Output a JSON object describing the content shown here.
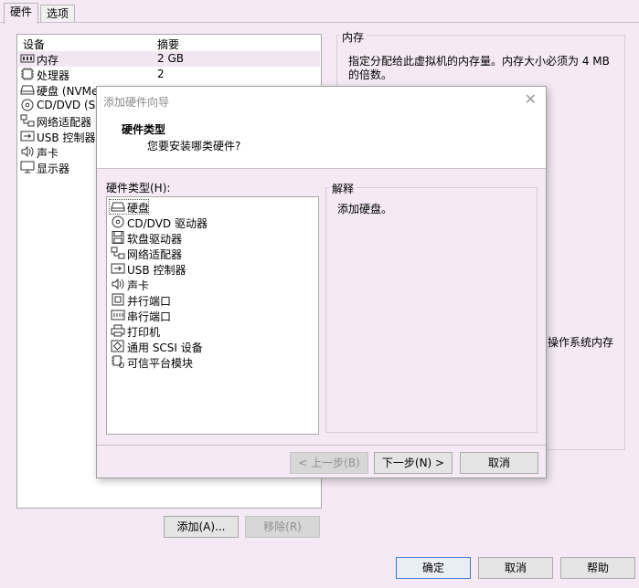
{
  "tabs": [
    {
      "label": "硬件",
      "active": true
    },
    {
      "label": "选项",
      "active": false
    }
  ],
  "device_table": {
    "headers": [
      "设备",
      "摘要"
    ],
    "rows": [
      {
        "icon": "memory-icon",
        "name": "内存",
        "summary": "2 GB",
        "selected": true
      },
      {
        "icon": "cpu-icon",
        "name": "处理器",
        "summary": "2"
      },
      {
        "icon": "harddisk-icon",
        "name": "硬盘 (NVMe)",
        "summary": ""
      },
      {
        "icon": "cd-icon",
        "name": "CD/DVD (SATA)",
        "summary": ""
      },
      {
        "icon": "network-icon",
        "name": "网络适配器",
        "summary": ""
      },
      {
        "icon": "usb-icon",
        "name": "USB 控制器",
        "summary": ""
      },
      {
        "icon": "sound-icon",
        "name": "声卡",
        "summary": ""
      },
      {
        "icon": "display-icon",
        "name": "显示器",
        "summary": ""
      }
    ]
  },
  "buttons": {
    "add": "添加(A)...",
    "remove": "移除(R)",
    "ok": "确定",
    "cancel": "取消",
    "help": "帮助"
  },
  "memory_panel": {
    "title": "内存",
    "description": "指定分配给此虚拟机的内存量。内存大小必须为 4 MB 的倍数。",
    "partial_text": "操作系统内存"
  },
  "wizard": {
    "title": "添加硬件向导",
    "heading": "硬件类型",
    "subheading": "您要安装哪类硬件?",
    "list_label": "硬件类型(H):",
    "items": [
      {
        "icon": "harddisk-icon",
        "label": "硬盘",
        "selected": true
      },
      {
        "icon": "cd-icon",
        "label": "CD/DVD 驱动器"
      },
      {
        "icon": "floppy-icon",
        "label": "软盘驱动器"
      },
      {
        "icon": "network-icon",
        "label": "网络适配器"
      },
      {
        "icon": "usb-icon",
        "label": "USB 控制器"
      },
      {
        "icon": "sound-icon",
        "label": "声卡"
      },
      {
        "icon": "parallel-port-icon",
        "label": "并行端口"
      },
      {
        "icon": "serial-port-icon",
        "label": "串行端口"
      },
      {
        "icon": "printer-icon",
        "label": "打印机"
      },
      {
        "icon": "scsi-icon",
        "label": "通用 SCSI 设备"
      },
      {
        "icon": "tpm-icon",
        "label": "可信平台模块"
      }
    ],
    "explanation_title": "解释",
    "explanation_text": "添加硬盘。",
    "back": "< 上一步(B)",
    "next": "下一步(N) >",
    "cancel": "取消"
  },
  "colors": {
    "background": "#f4e9f4",
    "selection": "#f3e6f3",
    "primary_border": "#3b78c6"
  }
}
